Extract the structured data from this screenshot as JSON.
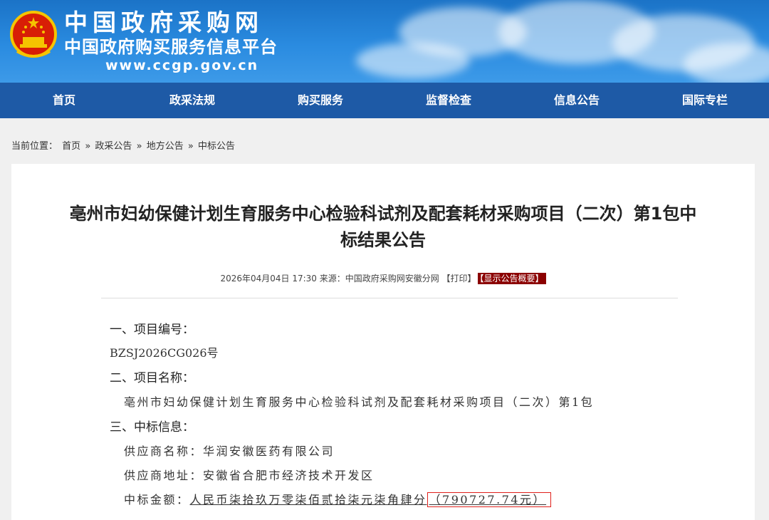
{
  "header": {
    "title": "中国政府采购网",
    "subtitle": "中国政府购买服务信息平台",
    "url": "www.ccgp.gov.cn",
    "emblem_icon": "national-emblem-icon"
  },
  "nav": [
    "首页",
    "政采法规",
    "购买服务",
    "监督检查",
    "信息公告",
    "国际专栏"
  ],
  "breadcrumb": {
    "prefix": "当前位置：",
    "items": [
      "首页",
      "政采公告",
      "地方公告",
      "中标公告"
    ],
    "separator": "»"
  },
  "article": {
    "title_line1": "亳州市妇幼保健计划生育服务中心检验科试剂及配套耗材采购项目（二次）第1包中",
    "title_line2": "标结果公告",
    "meta": "2026年04月04日 17:30 来源：中国政府采购网安徽分网 【打印】",
    "summary_tag": "【显示公告概要】",
    "sections": {
      "s1_heading": "一、项目编号：",
      "s1_value": "BZSJ2026CG026号",
      "s2_heading": "二、项目名称：",
      "s2_value": "亳州市妇幼保健计划生育服务中心检验科试剂及配套耗材采购项目（二次）第1包",
      "s3_heading": "三、中标信息：",
      "supplier_label": "供应商名称：",
      "supplier_value": "华润安徽医药有限公司",
      "address_label": "供应商地址：",
      "address_value": "安徽省合肥市经济技术开发区",
      "amount_label": "中标金额：",
      "amount_words": "人民币柒拾玖万零柒佰贰拾柒元柒角肆分",
      "amount_number": "（790727.74元）"
    }
  },
  "colors": {
    "header_blue": "#1b73c7",
    "nav_blue": "#1e5aa6",
    "tag_red": "#8b0000",
    "highlight_red": "#e0201b"
  }
}
